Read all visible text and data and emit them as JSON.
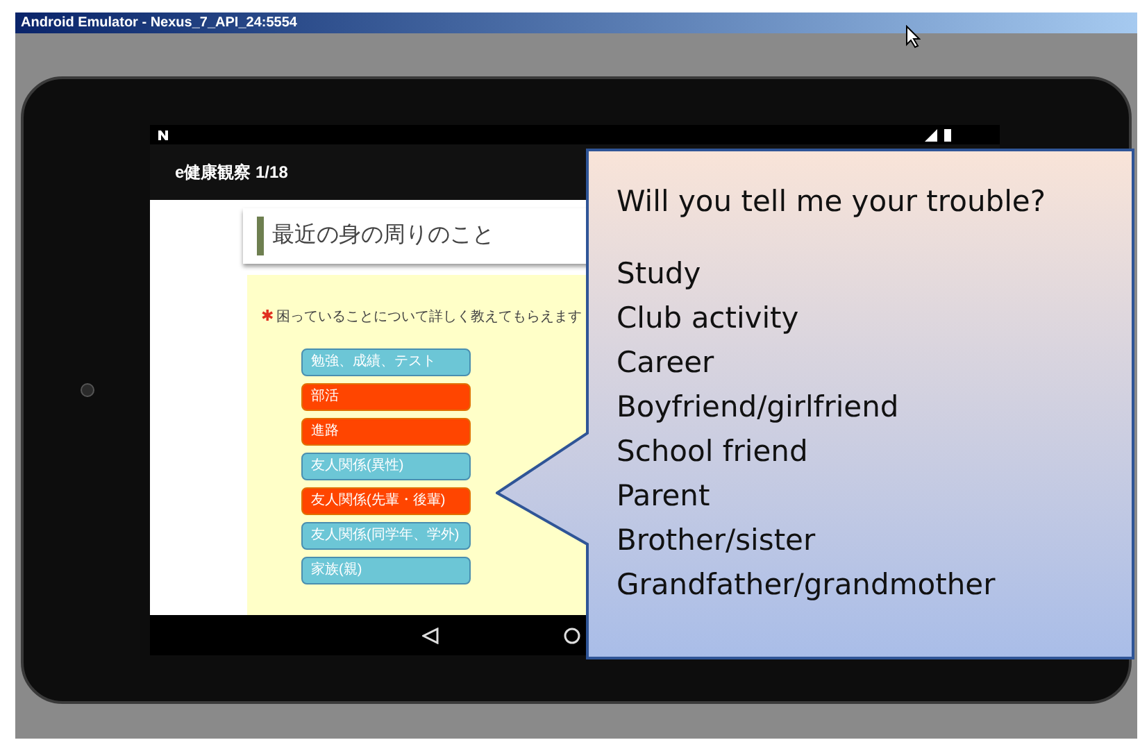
{
  "window": {
    "title": "Android Emulator - Nexus_7_API_24:5554"
  },
  "app_bar": {
    "title": "e健康観察 1/18"
  },
  "section": {
    "title": "最近の身の周りのこと"
  },
  "question": {
    "mark": "✱",
    "text": "困っていることについて詳しく教えてもらえます"
  },
  "options": [
    {
      "label": "勉強、成績、テスト",
      "selected": false
    },
    {
      "label": "部活",
      "selected": true
    },
    {
      "label": "進路",
      "selected": true
    },
    {
      "label": "友人関係(異性)",
      "selected": false
    },
    {
      "label": "友人関係(先輩・後輩)",
      "selected": true
    },
    {
      "label": "友人関係(同学年、学外)",
      "selected": false
    },
    {
      "label": "家族(親)",
      "selected": false
    }
  ],
  "callout": {
    "title": "Will you tell me your trouble?",
    "lines": [
      "Study",
      "Club activity",
      "Career",
      "Boyfriend/girlfriend",
      "School friend",
      "Parent",
      "Brother/sister",
      "Grandfather/grandmother"
    ]
  }
}
